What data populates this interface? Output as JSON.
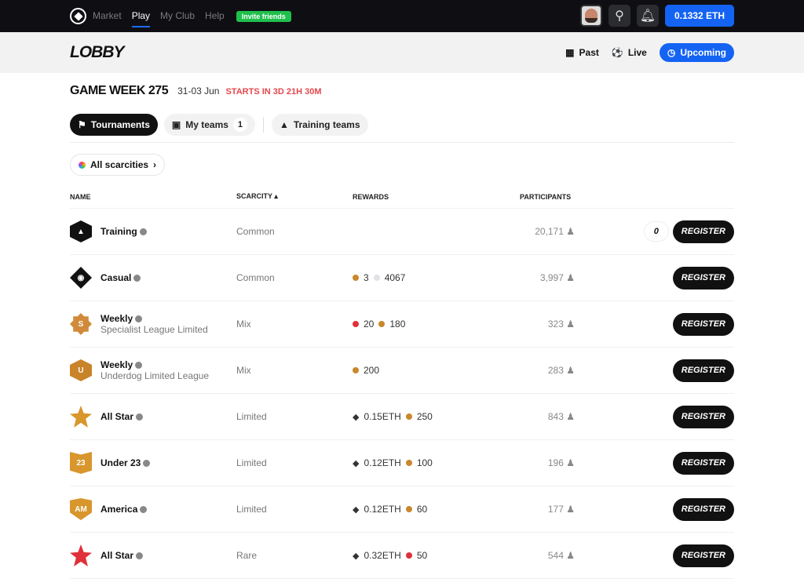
{
  "nav": {
    "items": [
      "Market",
      "Play",
      "My Club",
      "Help"
    ],
    "active": "Play",
    "invite": "Invite friends",
    "balance": "0.1332 ETH"
  },
  "lobby": {
    "title": "LOBBY",
    "filters": [
      "Past",
      "Live",
      "Upcoming"
    ],
    "active_filter": "Upcoming"
  },
  "gameweek": {
    "title": "GAME WEEK 275",
    "dates": "31-03 Jun",
    "countdown": "STARTS IN 3D 21H 30M"
  },
  "tabs": [
    {
      "label": "Tournaments"
    },
    {
      "label": "My teams",
      "count": "1"
    },
    {
      "label": "Training teams"
    }
  ],
  "scarcity_filter": "All scarcities",
  "table": {
    "headers": [
      "NAME",
      "SCARCITY ▴",
      "REWARDS",
      "PARTICIPANTS"
    ],
    "register_label": "REGISTER",
    "rows": [
      {
        "name": "Training",
        "sub": "",
        "scarcity": "Common",
        "rewards": [],
        "participants": "20,171",
        "lineups": "0",
        "badge_color": "#111"
      },
      {
        "name": "Casual",
        "sub": "",
        "scarcity": "Common",
        "rewards": [
          {
            "type": "dot",
            "color": "#c9882c",
            "value": "3"
          },
          {
            "type": "dot",
            "color": "#e2e2e6",
            "value": "4067"
          }
        ],
        "participants": "3,997",
        "badge_color": "#111"
      },
      {
        "name": "Weekly",
        "sub": "Specialist League Limited",
        "scarcity": "Mix",
        "rewards": [
          {
            "type": "dot",
            "color": "#e0303a",
            "value": "20"
          },
          {
            "type": "dot",
            "color": "#c9882c",
            "value": "180"
          }
        ],
        "participants": "323",
        "badge_color": "#d18a3a"
      },
      {
        "name": "Weekly",
        "sub": "Underdog Limited League",
        "scarcity": "Mix",
        "rewards": [
          {
            "type": "dot",
            "color": "#c9882c",
            "value": "200"
          }
        ],
        "participants": "283",
        "badge_color": "#c98328"
      },
      {
        "name": "All Star",
        "sub": "",
        "scarcity": "Limited",
        "rewards": [
          {
            "type": "eth",
            "value": "0.15ETH"
          },
          {
            "type": "dot",
            "color": "#c9882c",
            "value": "250"
          }
        ],
        "participants": "843",
        "badge_color": "#d8962c"
      },
      {
        "name": "Under 23",
        "sub": "",
        "scarcity": "Limited",
        "rewards": [
          {
            "type": "eth",
            "value": "0.12ETH"
          },
          {
            "type": "dot",
            "color": "#c9882c",
            "value": "100"
          }
        ],
        "participants": "196",
        "badge_color": "#d8962c"
      },
      {
        "name": "America",
        "sub": "",
        "scarcity": "Limited",
        "rewards": [
          {
            "type": "eth",
            "value": "0.12ETH"
          },
          {
            "type": "dot",
            "color": "#c9882c",
            "value": "60"
          }
        ],
        "participants": "177",
        "badge_color": "#d8962c"
      },
      {
        "name": "All Star",
        "sub": "",
        "scarcity": "Rare",
        "rewards": [
          {
            "type": "eth",
            "value": "0.32ETH"
          },
          {
            "type": "dot",
            "color": "#e0303a",
            "value": "50"
          }
        ],
        "participants": "544",
        "badge_color": "#e0303a"
      }
    ]
  }
}
